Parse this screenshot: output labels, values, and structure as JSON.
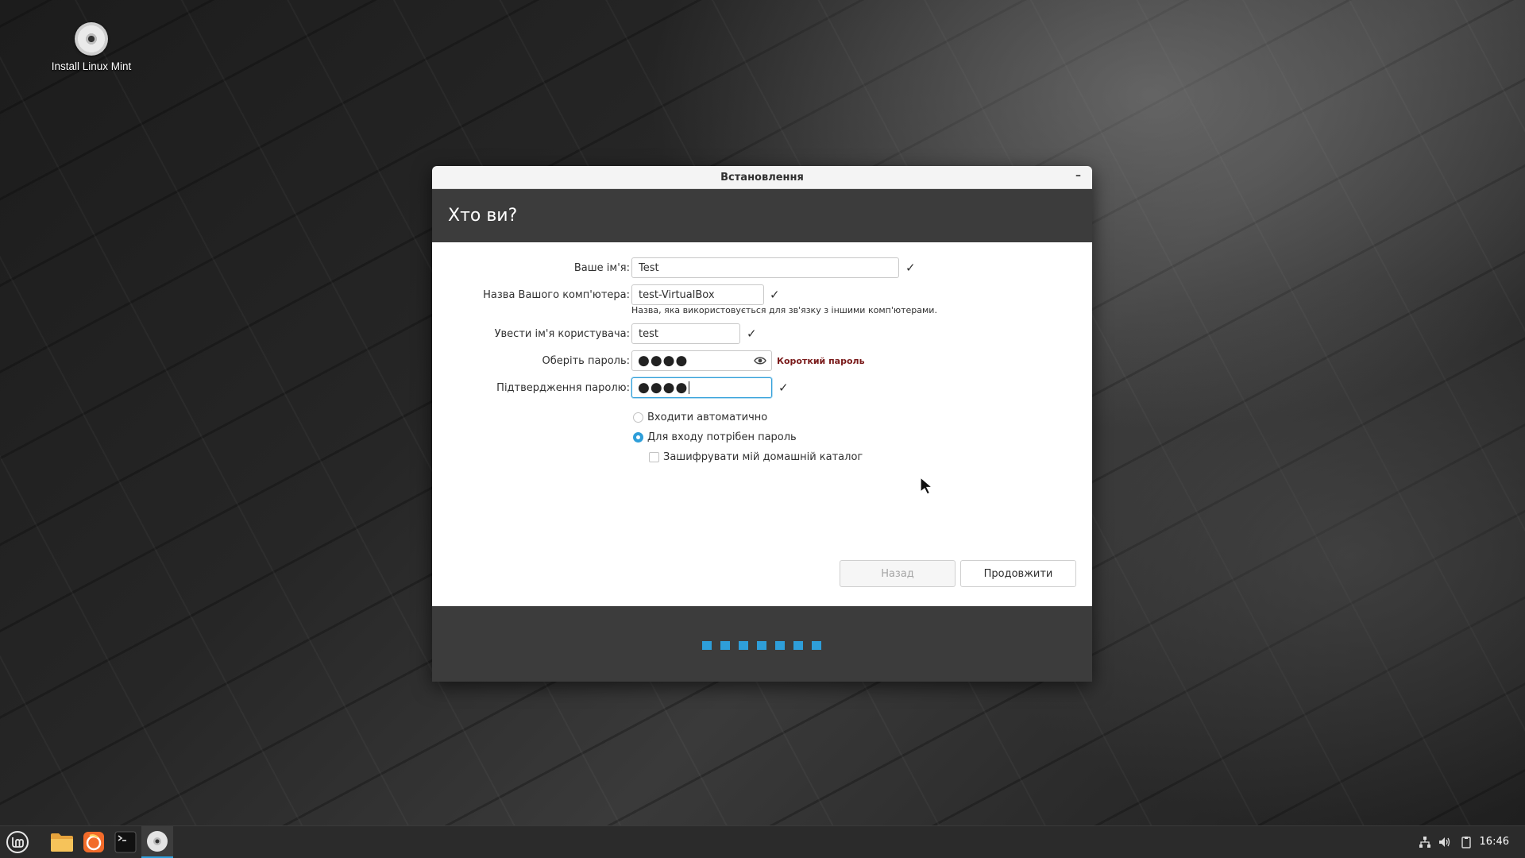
{
  "desktop": {
    "icons": [
      {
        "label": "Install Linux Mint",
        "icon": "disc-icon"
      }
    ]
  },
  "window": {
    "title": "Встановлення",
    "minimize_label": "–",
    "page_title": "Хто ви?"
  },
  "form": {
    "name_label": "Ваше ім'я:",
    "name_value": "Test",
    "computer_label": "Назва Вашого комп'ютера:",
    "computer_value": "test-VirtualBox",
    "computer_hint": "Назва, яка використовується для зв'язку з іншими комп'ютерами.",
    "username_label": "Увести ім'я користувача:",
    "username_value": "test",
    "password_label": "Оберіть пароль:",
    "password_masked": "●●●●",
    "password_warning": "Короткий пароль",
    "confirm_label": "Підтвердження паролю:",
    "confirm_masked": "●●●●",
    "check_mark": "✓",
    "login_auto_label": "Входити автоматично",
    "login_password_label": "Для входу потрібен пароль",
    "encrypt_label": "Зашифрувати мій домашній каталог",
    "login_auto_selected": false,
    "login_password_selected": true,
    "encrypt_checked": false
  },
  "buttons": {
    "back_label": "Назад",
    "continue_label": "Продовжити"
  },
  "progress": {
    "steps_total": 7,
    "accent_color": "#2e9ed9"
  },
  "taskbar": {
    "items": [
      {
        "name": "menu",
        "icon": "mint-logo-icon"
      },
      {
        "name": "files",
        "icon": "folder-icon"
      },
      {
        "name": "firefox",
        "icon": "firefox-icon"
      },
      {
        "name": "terminal",
        "icon": "terminal-icon"
      },
      {
        "name": "installer",
        "icon": "disc-icon",
        "active": true
      }
    ],
    "clock": "16:46"
  }
}
